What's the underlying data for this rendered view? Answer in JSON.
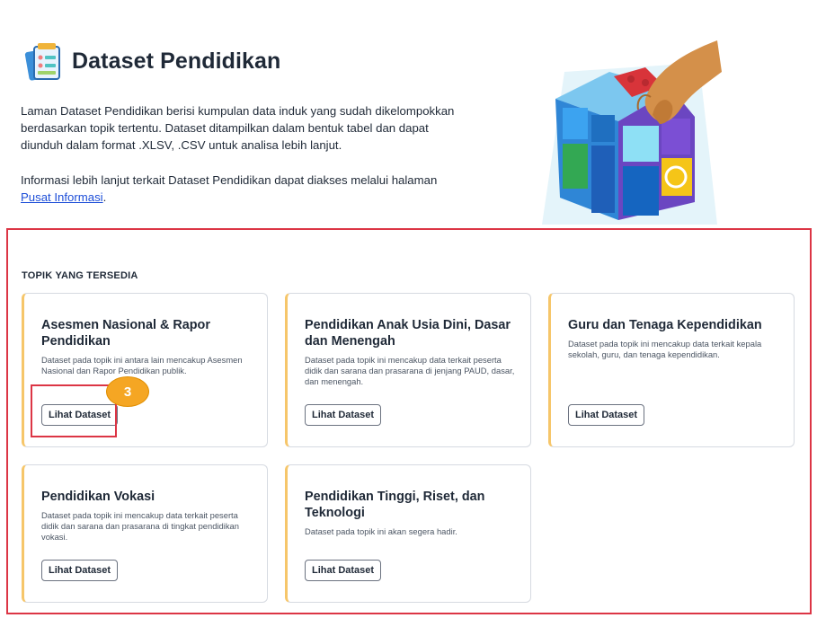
{
  "header": {
    "title": "Dataset Pendidikan",
    "intro": "Laman Dataset Pendidikan berisi kumpulan data induk yang sudah dikelompokkan berdasarkan topik tertentu. Dataset ditampilkan dalam bentuk tabel dan dapat diunduh dalam format .XLSV, .CSV untuk analisa lebih lanjut.",
    "info_text": "Informasi lebih lanjut terkait Dataset Pendidikan dapat diakses melalui halaman",
    "info_link": "Pusat Informasi",
    "info_suffix": ".",
    "icon": "document-chart-icon"
  },
  "section": {
    "label": "TOPIK YANG TERSEDIA"
  },
  "cards": [
    {
      "title": "Asesmen Nasional & Rapor Pendidikan",
      "desc": "Dataset pada topik ini antara lain mencakup Asesmen Nasional dan Rapor Pendidikan publik.",
      "button": "Lihat Dataset"
    },
    {
      "title": "Pendidikan Anak Usia Dini, Dasar dan Menengah",
      "desc": "Dataset pada topik ini mencakup data terkait peserta didik dan sarana dan prasarana di jenjang PAUD, dasar, dan menengah.",
      "button": "Lihat Dataset"
    },
    {
      "title": "Guru dan Tenaga Kependidikan",
      "desc": "Dataset pada topik ini mencakup data terkait kepala sekolah, guru, dan tenaga kependidikan.",
      "button": "Lihat Dataset"
    },
    {
      "title": "Pendidikan Vokasi",
      "desc": "Dataset pada topik ini mencakup data terkait peserta didik dan sarana dan prasarana di tingkat pendidikan vokasi.",
      "button": "Lihat Dataset"
    },
    {
      "title": "Pendidikan Tinggi, Riset, dan Teknologi",
      "desc": "Dataset pada topik ini akan segera hadir.",
      "button": "Lihat Dataset"
    }
  ],
  "annotation": {
    "step": "3"
  },
  "colors": {
    "accent": "#f6c66a",
    "highlight": "#dc3545",
    "badge": "#f5a623",
    "link": "#1d4ed8"
  }
}
